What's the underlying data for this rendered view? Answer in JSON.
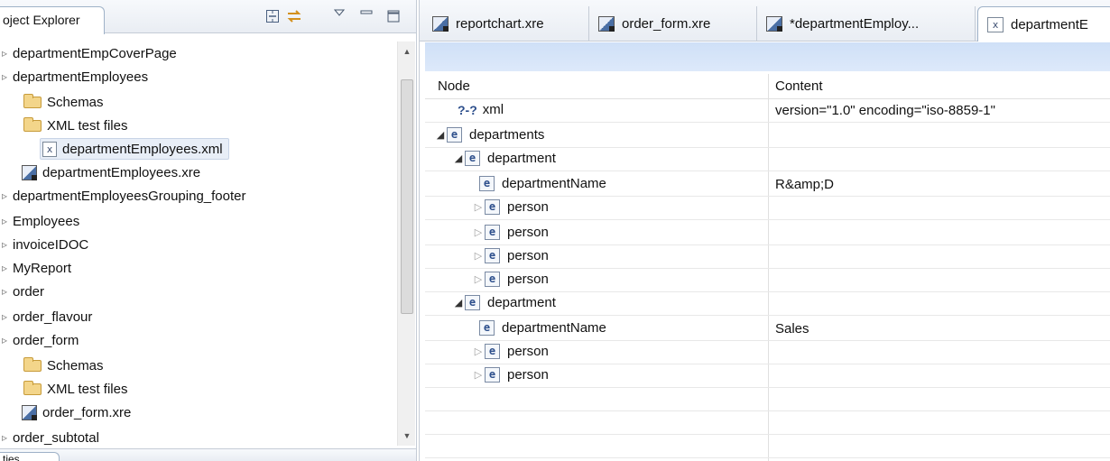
{
  "explorer": {
    "tab_label": "oject Explorer",
    "bottom_tab_label": "ties",
    "items": [
      {
        "label": "departmentEmpCoverPage",
        "kind": "project"
      },
      {
        "label": "departmentEmployees",
        "kind": "project"
      },
      {
        "label": "Schemas",
        "kind": "folder"
      },
      {
        "label": "XML test files",
        "kind": "folder"
      },
      {
        "label": "departmentEmployees.xml",
        "kind": "xml"
      },
      {
        "label": "departmentEmployees.xre",
        "kind": "xre"
      },
      {
        "label": "departmentEmployeesGrouping_footer",
        "kind": "project"
      },
      {
        "label": "Employees",
        "kind": "project"
      },
      {
        "label": "invoiceIDOC",
        "kind": "project"
      },
      {
        "label": "MyReport",
        "kind": "project"
      },
      {
        "label": "order",
        "kind": "project"
      },
      {
        "label": "order_flavour",
        "kind": "project"
      },
      {
        "label": "order_form",
        "kind": "project"
      },
      {
        "label": "Schemas",
        "kind": "folder"
      },
      {
        "label": "XML test files",
        "kind": "folder"
      },
      {
        "label": "order_form.xre",
        "kind": "xre"
      },
      {
        "label": "order_subtotal",
        "kind": "project"
      }
    ]
  },
  "editor": {
    "tabs": [
      {
        "label": "reportchart.xre",
        "kind": "xre"
      },
      {
        "label": "order_form.xre",
        "kind": "xre"
      },
      {
        "label": "*departmentEmploy...",
        "kind": "xre"
      },
      {
        "label": "departmentE",
        "kind": "xml"
      }
    ],
    "columns": {
      "node": "Node",
      "content": "Content"
    },
    "rows": [
      {
        "name": "xml",
        "content": "version=\"1.0\" encoding=\"iso-8859-1\"",
        "type": "pi",
        "depth": 0,
        "expander": "none"
      },
      {
        "name": "departments",
        "content": "",
        "type": "e",
        "depth": 0,
        "expander": "open"
      },
      {
        "name": "department",
        "content": "",
        "type": "e",
        "depth": 1,
        "expander": "open"
      },
      {
        "name": "departmentName",
        "content": "R&amp;D",
        "type": "e",
        "depth": 2,
        "expander": "none"
      },
      {
        "name": "person",
        "content": "",
        "type": "e",
        "depth": 2,
        "expander": "closed"
      },
      {
        "name": "person",
        "content": "",
        "type": "e",
        "depth": 2,
        "expander": "closed"
      },
      {
        "name": "person",
        "content": "",
        "type": "e",
        "depth": 2,
        "expander": "closed"
      },
      {
        "name": "person",
        "content": "",
        "type": "e",
        "depth": 2,
        "expander": "closed"
      },
      {
        "name": "department",
        "content": "",
        "type": "e",
        "depth": 1,
        "expander": "open"
      },
      {
        "name": "departmentName",
        "content": "Sales",
        "type": "e",
        "depth": 2,
        "expander": "none"
      },
      {
        "name": "person",
        "content": "",
        "type": "e",
        "depth": 2,
        "expander": "closed"
      },
      {
        "name": "person",
        "content": "",
        "type": "e",
        "depth": 2,
        "expander": "closed"
      }
    ],
    "pi_label": "?-?",
    "element_label": "e"
  }
}
